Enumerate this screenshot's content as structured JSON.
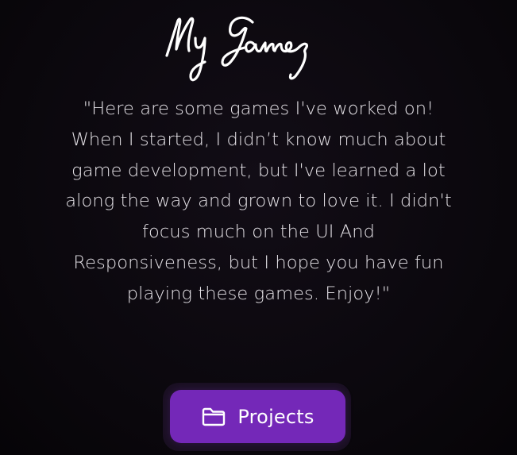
{
  "title": "My Games",
  "intro_lines": [
    "\"Here are some games I've worked on!",
    "When I started, I didn’t know much about",
    "game development, but I've learned a lot",
    "along the way and grown to love it. I didn't",
    "focus much on the UI And",
    "Responsiveness, but I hope you have fun",
    "playing these games. Enjoy!\""
  ],
  "projects_button": {
    "label": "Projects",
    "icon": "folder-icon",
    "color": "#7428b8"
  },
  "colors": {
    "background": "#0b080d",
    "text": "#e4e1e6",
    "accent": "#7428b8"
  }
}
